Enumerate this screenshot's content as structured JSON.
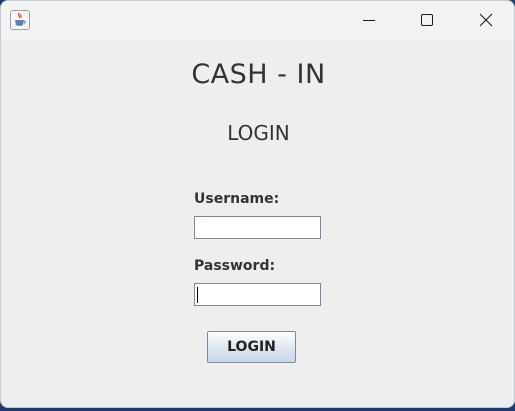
{
  "window": {
    "icon": "java-cup-icon",
    "controls": {
      "minimize": "minimize-icon",
      "maximize": "maximize-icon",
      "close": "close-icon"
    }
  },
  "form": {
    "app_title": "CASH - IN",
    "section_title": "LOGIN",
    "username_label": "Username:",
    "username_value": "",
    "password_label": "Password:",
    "password_value": "",
    "login_button": "LOGIN"
  },
  "colors": {
    "window_bg": "#eeeeee",
    "titlebar_bg": "#f3f3f3",
    "text": "#333333",
    "button_gradient_end": "#c9d6e6"
  }
}
